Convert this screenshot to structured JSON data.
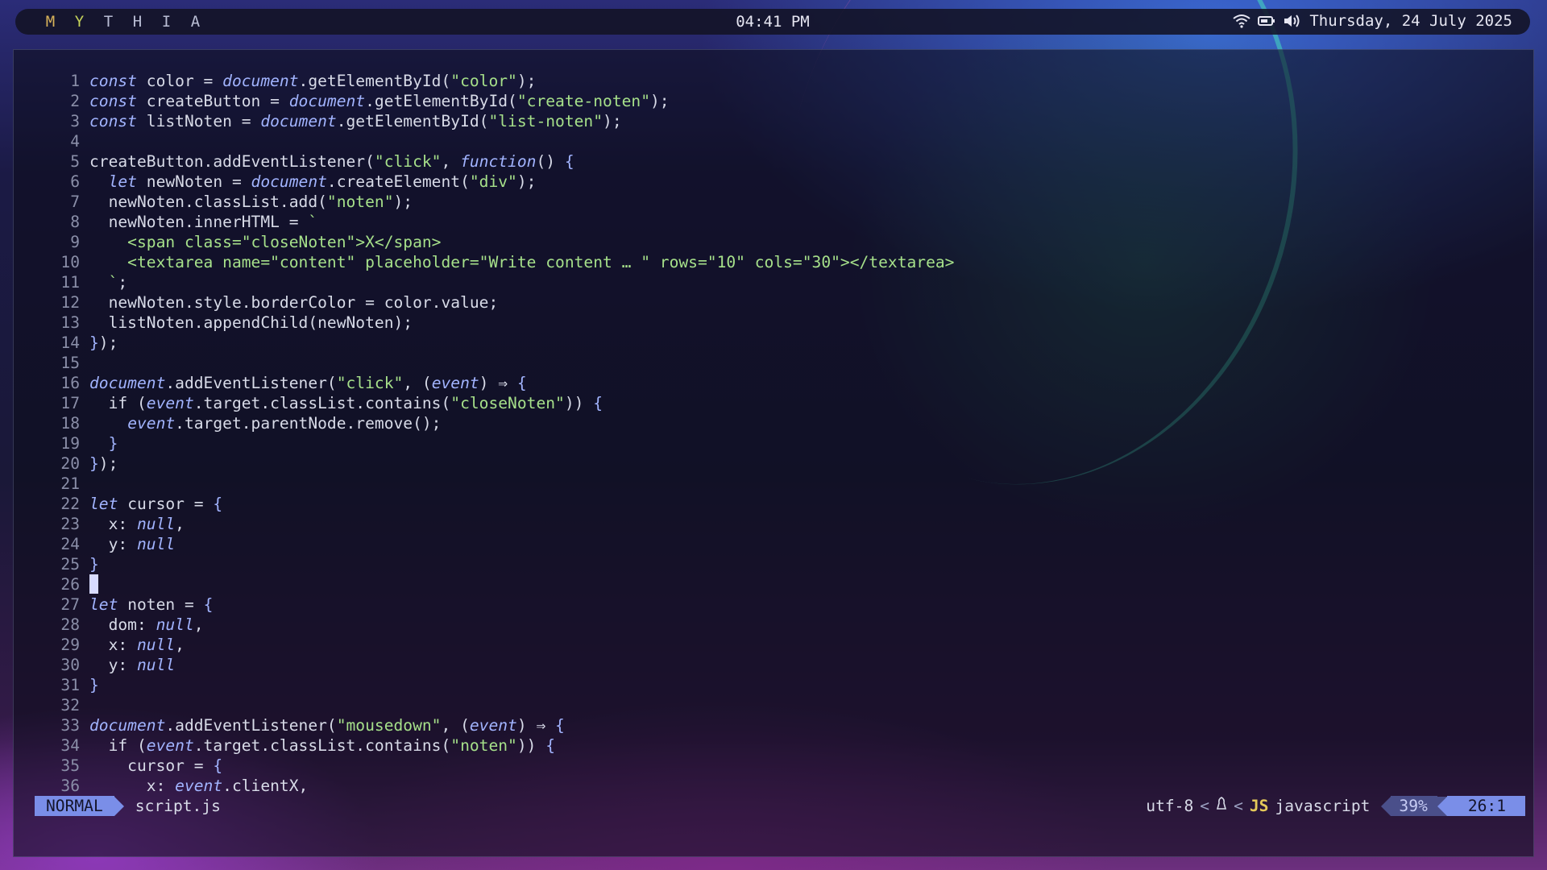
{
  "topbar": {
    "workspaces": [
      {
        "label": "M",
        "color": "#d7b25a"
      },
      {
        "label": "Y",
        "color": "#c4d25a"
      },
      {
        "label": "T",
        "color": "#b9bdd4"
      },
      {
        "label": "H",
        "color": "#b9bdd4"
      },
      {
        "label": "I",
        "color": "#b9bdd4"
      },
      {
        "label": "A",
        "color": "#b9bdd4"
      }
    ],
    "clock": "04:41 PM",
    "date": "Thursday, 24 July 2025",
    "icons": [
      "wifi-icon",
      "battery-icon",
      "volume-icon"
    ]
  },
  "editor": {
    "lines": [
      {
        "n": "1",
        "t": [
          [
            "k",
            "const"
          ],
          [
            "",
            "color = "
          ],
          [
            "k",
            "document"
          ],
          [
            "",
            ".getElementById("
          ],
          [
            "s",
            "\"color\""
          ],
          [
            "",
            ");"
          ]
        ]
      },
      {
        "n": "2",
        "t": [
          [
            "k",
            "const"
          ],
          [
            "",
            "createButton = "
          ],
          [
            "k",
            "document"
          ],
          [
            "",
            ".getElementById("
          ],
          [
            "s",
            "\"create-noten\""
          ],
          [
            "",
            ");"
          ]
        ]
      },
      {
        "n": "3",
        "t": [
          [
            "k",
            "const"
          ],
          [
            "",
            "listNoten = "
          ],
          [
            "k",
            "document"
          ],
          [
            "",
            ".getElementById("
          ],
          [
            "s",
            "\"list-noten\""
          ],
          [
            "",
            ");"
          ]
        ]
      },
      {
        "n": "4",
        "t": []
      },
      {
        "n": "5",
        "t": [
          [
            "",
            "createButton.addEventListener("
          ],
          [
            "s",
            "\"click\""
          ],
          [
            "",
            ", "
          ],
          [
            "k",
            "function"
          ],
          [
            "",
            "() "
          ],
          [
            "p",
            "{"
          ]
        ]
      },
      {
        "n": "6",
        "t": [
          [
            "",
            "  "
          ],
          [
            "k",
            "let"
          ],
          [
            "",
            "newNoten = "
          ],
          [
            "k",
            "document"
          ],
          [
            "",
            ".createElement("
          ],
          [
            "s",
            "\"div\""
          ],
          [
            "",
            ");"
          ]
        ]
      },
      {
        "n": "7",
        "t": [
          [
            "",
            "  newNoten.classList.add("
          ],
          [
            "s",
            "\"noten\""
          ],
          [
            "",
            ");"
          ]
        ]
      },
      {
        "n": "8",
        "t": [
          [
            "",
            "  newNoten.innerHTML = "
          ],
          [
            "s",
            "`"
          ]
        ]
      },
      {
        "n": "9",
        "t": [
          [
            "s",
            "    <span class=\"closeNoten\">X</span>"
          ]
        ]
      },
      {
        "n": "10",
        "t": [
          [
            "s",
            "    <textarea name=\"content\" placeholder=\"Write content … \" rows=\"10\" cols=\"30\"></textarea>"
          ]
        ]
      },
      {
        "n": "11",
        "t": [
          [
            "s",
            "  `"
          ],
          [
            "",
            ";"
          ]
        ]
      },
      {
        "n": "12",
        "t": [
          [
            "",
            "  newNoten.style.borderColor = color.value;"
          ]
        ]
      },
      {
        "n": "13",
        "t": [
          [
            "",
            "  listNoten.appendChild(newNoten);"
          ]
        ]
      },
      {
        "n": "14",
        "t": [
          [
            "p",
            "}"
          ],
          [
            "",
            ");"
          ]
        ]
      },
      {
        "n": "15",
        "t": []
      },
      {
        "n": "16",
        "t": [
          [
            "k",
            "document"
          ],
          [
            "",
            ".addEventListener("
          ],
          [
            "s",
            "\"click\""
          ],
          [
            "",
            ", ("
          ],
          [
            "k",
            "event"
          ],
          [
            "",
            ") ⇒ "
          ],
          [
            "p",
            "{"
          ]
        ]
      },
      {
        "n": "17",
        "t": [
          [
            "",
            "  if ("
          ],
          [
            "k",
            "event"
          ],
          [
            "",
            ".target.classList.contains("
          ],
          [
            "s",
            "\"closeNoten\""
          ],
          [
            "",
            ")) "
          ],
          [
            "p",
            "{"
          ]
        ]
      },
      {
        "n": "18",
        "t": [
          [
            "",
            "    "
          ],
          [
            "k",
            "event"
          ],
          [
            "",
            ".target.parentNode.remove();"
          ]
        ]
      },
      {
        "n": "19",
        "t": [
          [
            "",
            "  "
          ],
          [
            "p",
            "}"
          ]
        ]
      },
      {
        "n": "20",
        "t": [
          [
            "p",
            "}"
          ],
          [
            "",
            ");"
          ]
        ]
      },
      {
        "n": "21",
        "t": []
      },
      {
        "n": "22",
        "t": [
          [
            "k",
            "let"
          ],
          [
            "",
            "cursor = "
          ],
          [
            "p",
            "{"
          ]
        ]
      },
      {
        "n": "23",
        "t": [
          [
            "",
            "  x: "
          ],
          [
            "k",
            "null"
          ],
          [
            "",
            ","
          ]
        ]
      },
      {
        "n": "24",
        "t": [
          [
            "",
            "  y: "
          ],
          [
            "k",
            "null"
          ]
        ]
      },
      {
        "n": "25",
        "t": [
          [
            "p",
            "}"
          ]
        ]
      },
      {
        "n": "26",
        "t": [
          [
            "cursor",
            ""
          ]
        ]
      },
      {
        "n": "27",
        "t": [
          [
            "k",
            "let"
          ],
          [
            "",
            "noten = "
          ],
          [
            "p",
            "{"
          ]
        ]
      },
      {
        "n": "28",
        "t": [
          [
            "",
            "  dom: "
          ],
          [
            "k",
            "null"
          ],
          [
            "",
            ","
          ]
        ]
      },
      {
        "n": "29",
        "t": [
          [
            "",
            "  x: "
          ],
          [
            "k",
            "null"
          ],
          [
            "",
            ","
          ]
        ]
      },
      {
        "n": "30",
        "t": [
          [
            "",
            "  y: "
          ],
          [
            "k",
            "null"
          ]
        ]
      },
      {
        "n": "31",
        "t": [
          [
            "p",
            "}"
          ]
        ]
      },
      {
        "n": "32",
        "t": []
      },
      {
        "n": "33",
        "t": [
          [
            "k",
            "document"
          ],
          [
            "",
            ".addEventListener("
          ],
          [
            "s",
            "\"mousedown\""
          ],
          [
            "",
            ", ("
          ],
          [
            "k",
            "event"
          ],
          [
            "",
            ") ⇒ "
          ],
          [
            "p",
            "{"
          ]
        ]
      },
      {
        "n": "34",
        "t": [
          [
            "",
            "  if ("
          ],
          [
            "k",
            "event"
          ],
          [
            "",
            ".target.classList.contains("
          ],
          [
            "s",
            "\"noten\""
          ],
          [
            "",
            ")) "
          ],
          [
            "p",
            "{"
          ]
        ]
      },
      {
        "n": "35",
        "t": [
          [
            "",
            "    cursor = "
          ],
          [
            "p",
            "{"
          ]
        ]
      },
      {
        "n": "36",
        "t": [
          [
            "",
            "      x: "
          ],
          [
            "k",
            "event"
          ],
          [
            "",
            ".clientX,"
          ]
        ]
      }
    ]
  },
  "statusline": {
    "mode": "NORMAL",
    "filename": "script.js",
    "encoding": "utf-8",
    "filetype_icon": "JS",
    "filetype": "javascript",
    "percent": "39%",
    "position": "26:1"
  }
}
